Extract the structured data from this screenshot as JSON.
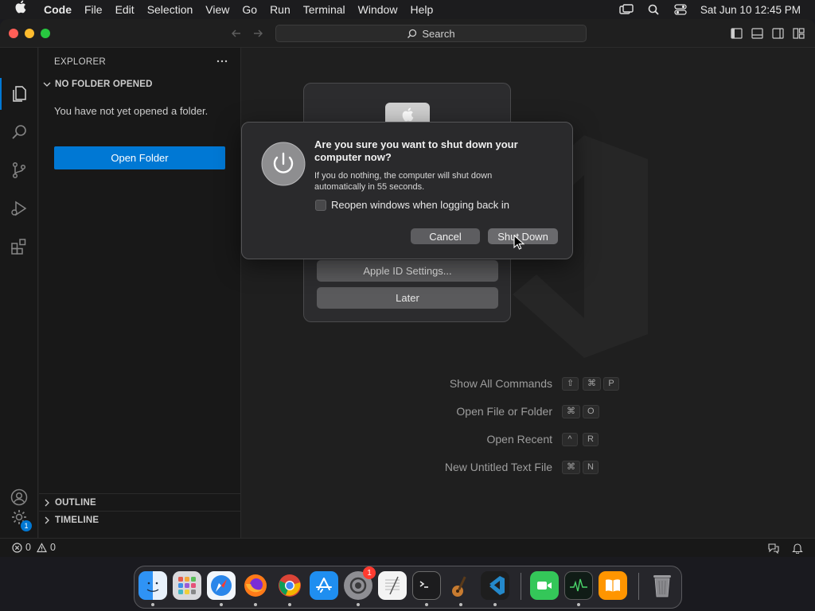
{
  "menubar": {
    "items": [
      "Code",
      "File",
      "Edit",
      "Selection",
      "View",
      "Go",
      "Run",
      "Terminal",
      "Window",
      "Help"
    ],
    "clock": "Sat Jun 10  12:45 PM"
  },
  "titlebar": {
    "search_label": "Search"
  },
  "sidebar": {
    "title": "EXPLORER",
    "section": "NO FOLDER OPENED",
    "message": "You have not yet opened a folder.",
    "open_folder": "Open Folder",
    "outline": "OUTLINE",
    "timeline": "TIMELINE"
  },
  "activity": {
    "settings_badge": "1"
  },
  "editor": {
    "commands": [
      {
        "label": "Show All Commands",
        "keys": [
          "⇧",
          "⌘",
          "P"
        ]
      },
      {
        "label": "Open File or Folder",
        "keys": [
          "⌘",
          "O"
        ]
      },
      {
        "label": "Open Recent",
        "keys": [
          "^",
          "R"
        ]
      },
      {
        "label": "New Untitled Text File",
        "keys": [
          "⌘",
          "N"
        ]
      }
    ]
  },
  "status": {
    "errors": "0",
    "warnings": "0"
  },
  "update_dialog": {
    "apple_id_btn": "Apple ID Settings...",
    "later_btn": "Later"
  },
  "shutdown_dialog": {
    "title": "Are you sure you want to shut down your computer now?",
    "message": "If you do nothing, the computer will shut down automatically in 55 seconds.",
    "checkbox_label": "Reopen windows when logging back in",
    "cancel": "Cancel",
    "confirm": "Shut Down"
  },
  "dock": {
    "settings_badge": "1"
  },
  "colors": {
    "accent": "#0078d4",
    "close": "#ff5f57",
    "minimize": "#febc2e",
    "zoom": "#28c840"
  }
}
